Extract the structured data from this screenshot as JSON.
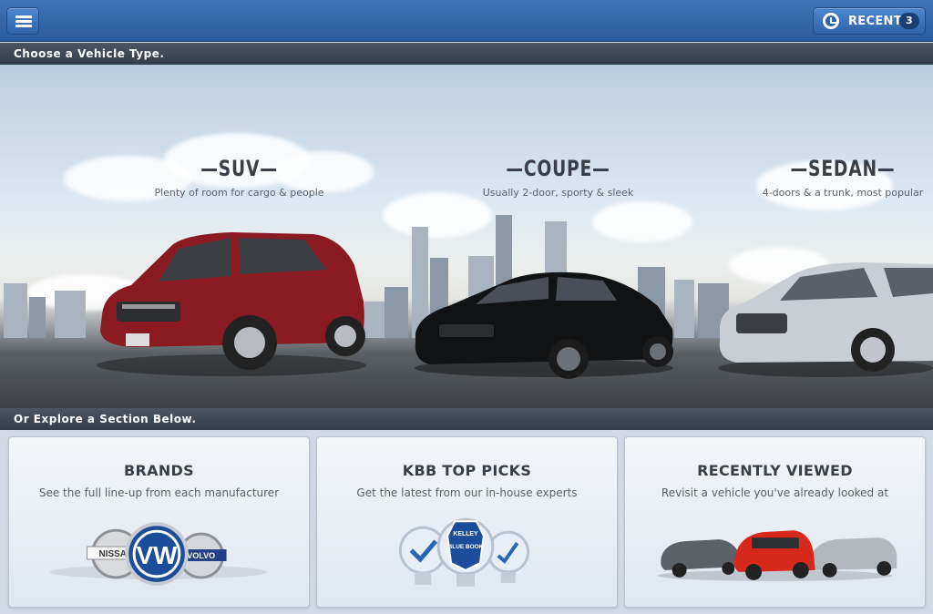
{
  "header": {
    "menu_icon": "hamburger-menu-icon",
    "recent_icon": "clock-icon",
    "recent_label": "RECENT",
    "recent_count": "3",
    "accent_color": "#2b5aa0"
  },
  "vehicle_section": {
    "label": "Choose a Vehicle Type.",
    "types": [
      {
        "title": "SUV",
        "description": "Plenty of room for cargo & people",
        "car_color": "#8a1a22"
      },
      {
        "title": "COUPE",
        "description": "Usually 2-door, sporty & sleek",
        "car_color": "#111214"
      },
      {
        "title": "SEDAN",
        "description": "4-doors & a trunk, most popular",
        "car_color": "#c9ced4"
      }
    ]
  },
  "explore_section": {
    "label": "Or Explore a Section Below.",
    "cards": [
      {
        "title": "BRANDS",
        "description": "See the full line-up from each manufacturer",
        "logos": [
          "NISSAN",
          "VW",
          "VOLVO"
        ]
      },
      {
        "title": "KBB TOP PICKS",
        "description": "Get the latest from our in-house experts",
        "badge_text": [
          "KELLEY",
          "BLUE BOOK"
        ]
      },
      {
        "title": "RECENTLY VIEWED",
        "description": "Revisit a vehicle you've already looked at"
      }
    ]
  }
}
